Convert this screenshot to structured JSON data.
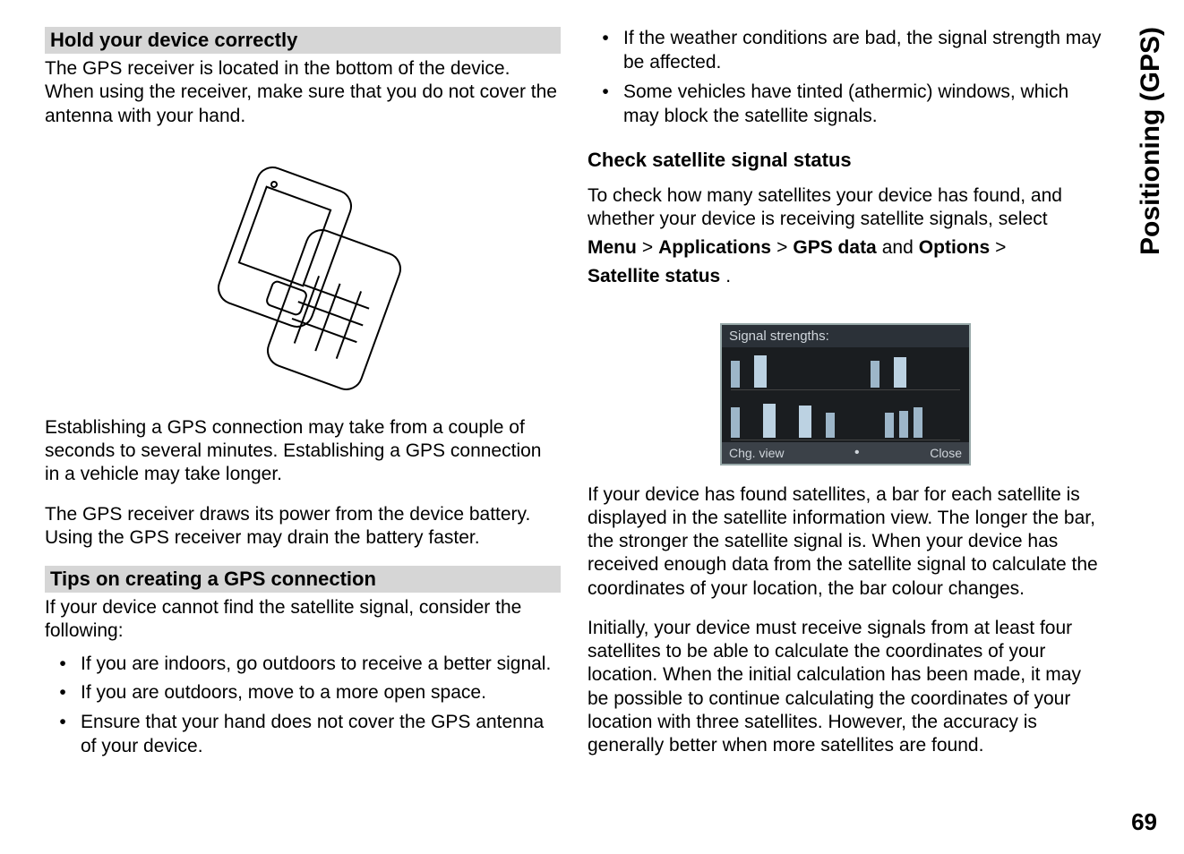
{
  "sideTab": "Positioning (GPS)",
  "pageNumber": "69",
  "left": {
    "h1": "Hold your device correctly",
    "p1": "The GPS receiver is located in the bottom of the device. When using the receiver, make sure that you do not cover the antenna with your hand.",
    "p2": "Establishing a GPS connection may take from a couple of seconds to several minutes. Establishing a GPS connection in a vehicle may take longer.",
    "p3": "The GPS receiver draws its power from the device battery. Using the GPS receiver may drain the battery faster.",
    "h2": "Tips on creating a GPS connection",
    "p4": "If your device cannot find the satellite signal, consider the following:",
    "bullets": [
      "If you are indoors, go outdoors to receive a better signal.",
      "If you are outdoors, move to a more open space.",
      "Ensure that your hand does not cover the GPS antenna of your device."
    ]
  },
  "right": {
    "topBullets": [
      "If the weather conditions are bad, the signal strength may be affected.",
      "Some vehicles have tinted (athermic) windows, which may block the satellite signals."
    ],
    "h1": "Check satellite signal status",
    "navPre": "To check how many satellites your device has found, and whether your device is receiving satellite signals, select",
    "navMenu": "Menu",
    "navSep": ">",
    "navApps": "Applications",
    "navGps": "GPS data",
    "navAnd": "and",
    "navOptions": "Options",
    "navSat": "Satellite status",
    "navDot": ".",
    "screenshot": {
      "title": "Signal strengths:",
      "leftKey": "Chg. view",
      "rightKey": "Close"
    },
    "p1": "If your device has found satellites, a bar for each satellite is displayed in the satellite information view. The longer the bar, the stronger the satellite signal is. When your device has received enough data from the satellite signal to calculate the coordinates of your location, the bar colour changes.",
    "p2": "Initially, your device must receive signals from at least four satellites to be able to calculate the coordinates of your location. When the initial calculation has been made, it may be possible to continue calculating the coordinates of your location with three satellites. However, the accuracy is generally better when more satellites are found."
  }
}
